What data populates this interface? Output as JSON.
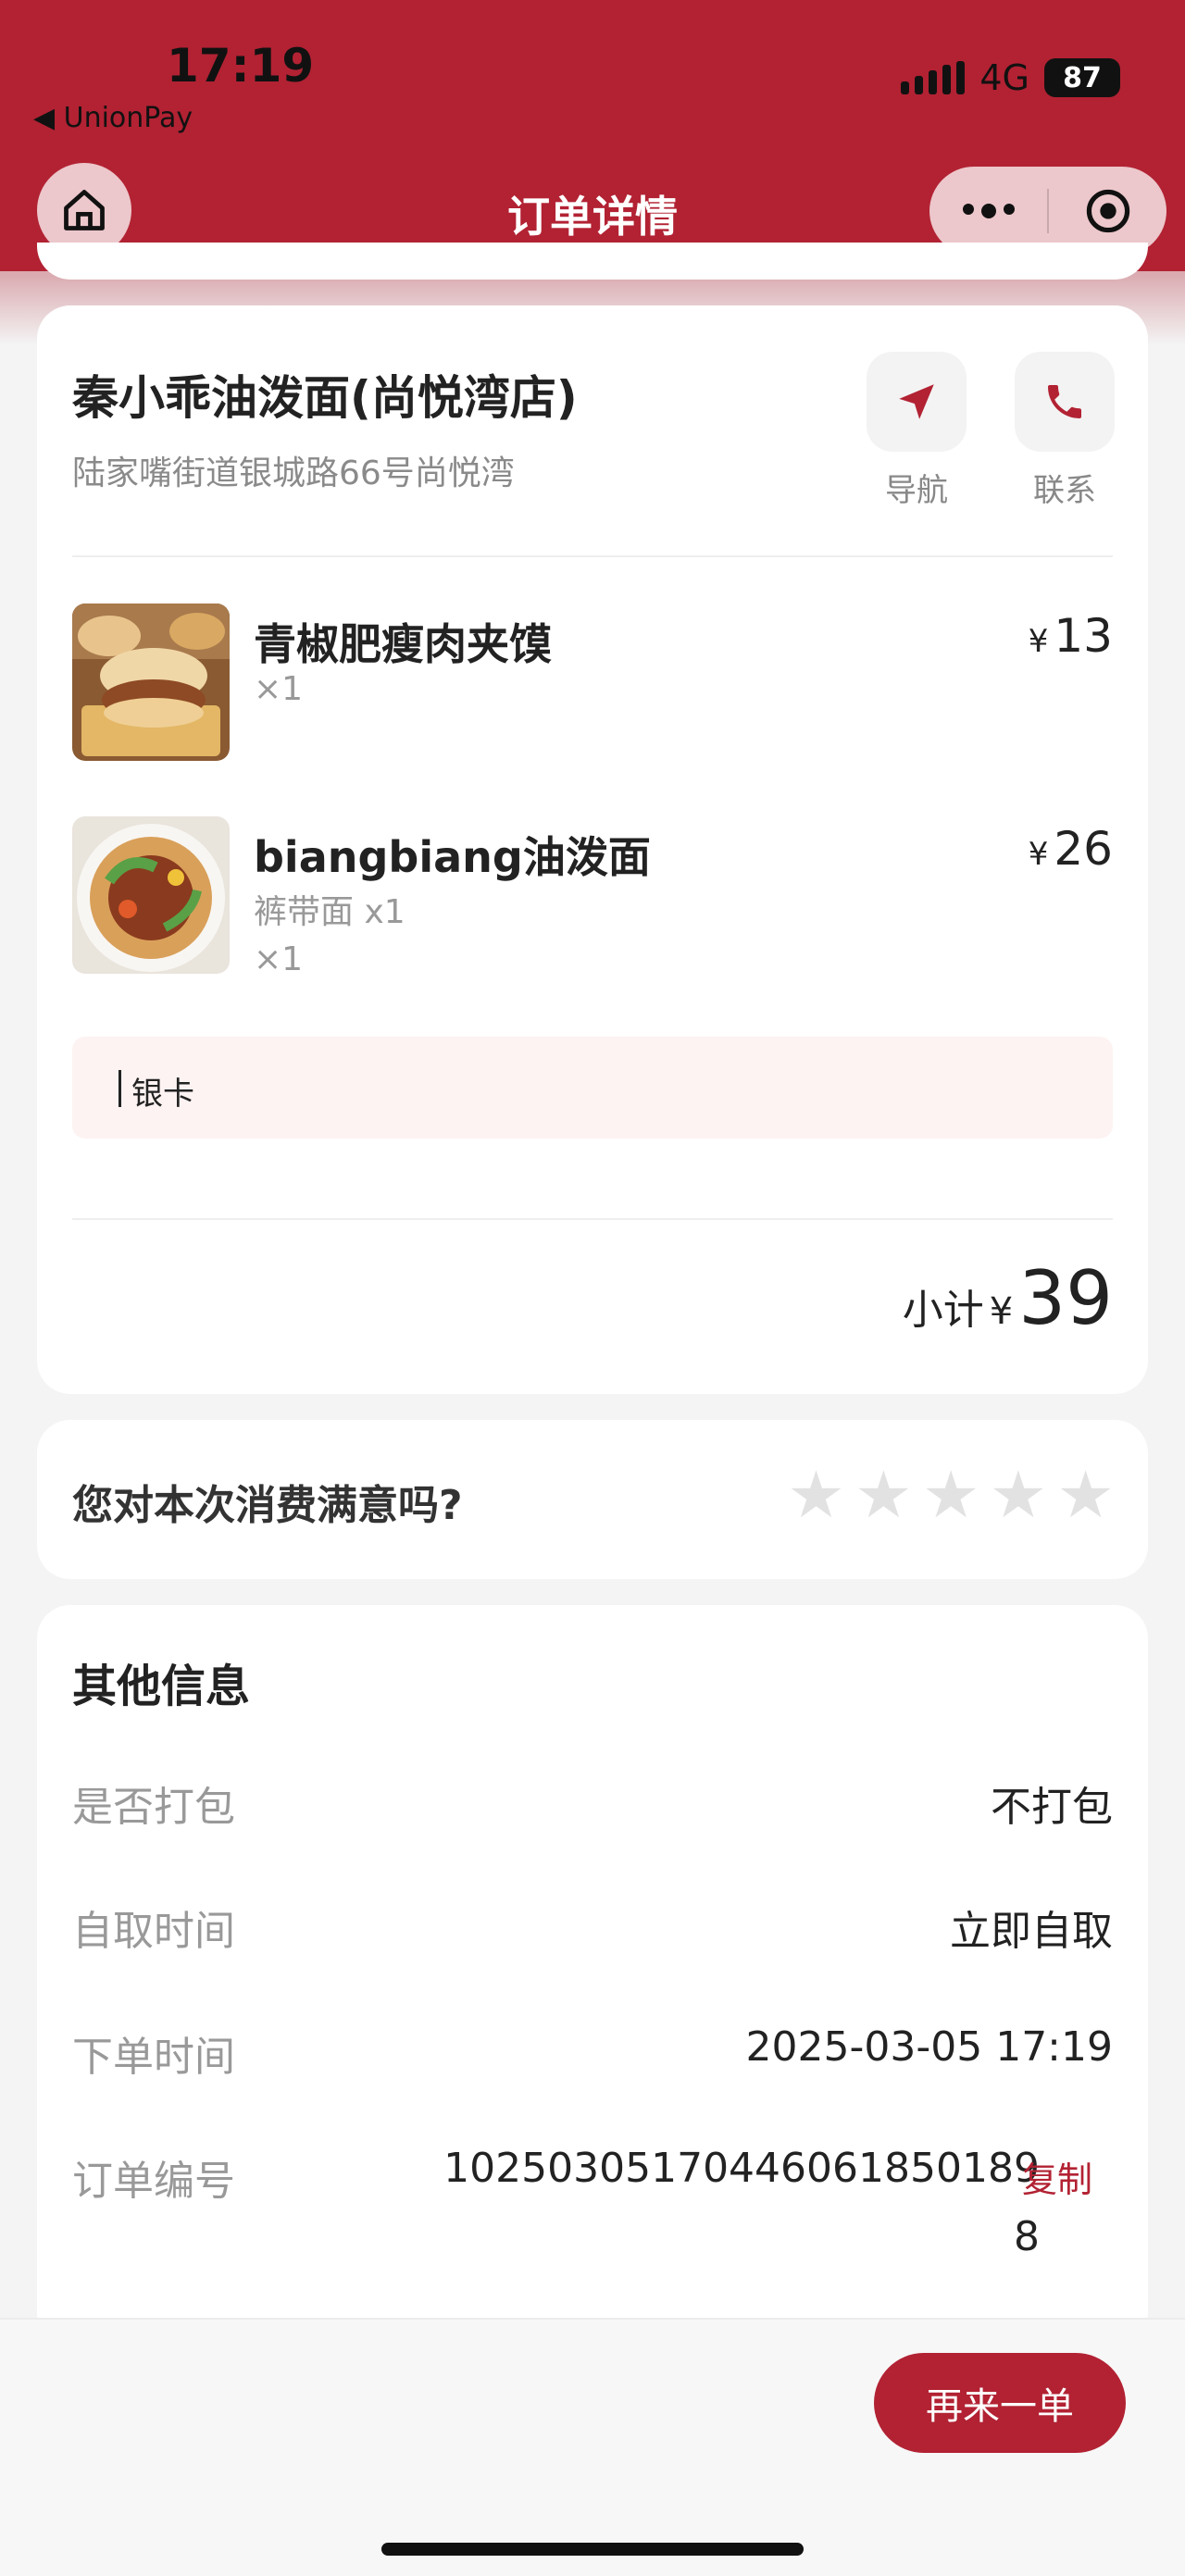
{
  "status_bar": {
    "time": "17:19",
    "back_app": "◀ UnionPay",
    "network": "4G",
    "battery": "87"
  },
  "nav": {
    "title": "订单详情"
  },
  "store": {
    "name": "秦小乖油泼面(尚悦湾店)",
    "address": "陆家嘴街道银城路66号尚悦湾",
    "nav_label": "导航",
    "contact_label": "联系"
  },
  "items": [
    {
      "name": "青椒肥瘦肉夹馍",
      "qty": "×1",
      "currency": "¥",
      "price": "13"
    },
    {
      "name": "biangbiang油泼面",
      "spec": "裤带面 x1",
      "qty": "×1",
      "currency": "¥",
      "price": "26"
    }
  ],
  "note": "银卡",
  "subtotal": {
    "label": "小计",
    "currency": "¥",
    "value": "39"
  },
  "rating": {
    "question": "您对本次消费满意吗?",
    "stars_selected": 0,
    "stars_total": 5
  },
  "other_info": {
    "title": "其他信息",
    "packing_label": "是否打包",
    "packing_value": "不打包",
    "pickup_label": "自取时间",
    "pickup_value": "立即自取",
    "order_time_label": "下单时间",
    "order_time_value": "2025-03-05 17:19",
    "order_no_label": "订单编号",
    "order_no_value": "102503051704460618501898",
    "copy_label": "复制"
  },
  "bottom": {
    "reorder_label": "再来一单"
  },
  "colors": {
    "brand": "#b22233",
    "star_empty": "#e2e2e2"
  }
}
